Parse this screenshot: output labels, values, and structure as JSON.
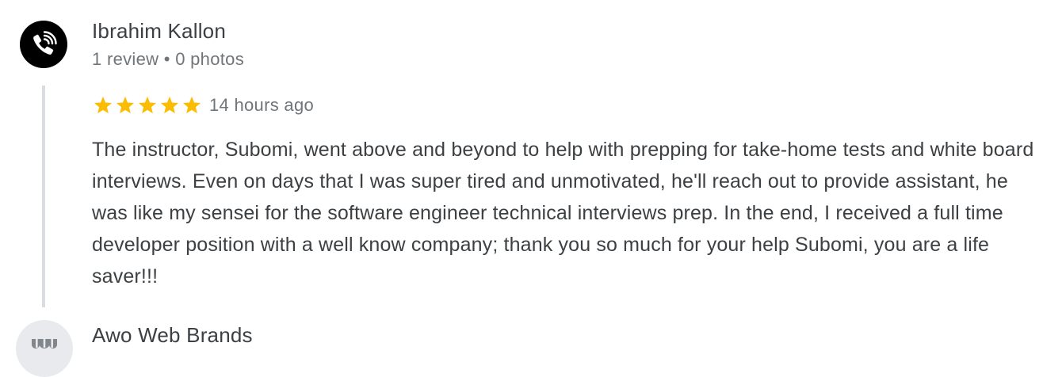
{
  "reviews": [
    {
      "reviewer_name": "Ibrahim Kallon",
      "review_count": "1 review",
      "meta_separator": "•",
      "photo_count": "0 photos",
      "avatar_icon": "phone-ringing-icon",
      "rating": 5,
      "rating_max": 5,
      "time_ago": "14 hours ago",
      "text": "The instructor, Subomi, went above and beyond to help with prepping for take-home tests and white board interviews. Even on days that I was super tired and unmotivated, he'll reach out to provide assistant, he was like my sensei for the software engineer technical interviews prep. In the end, I received a full time developer position with a well know company; thank you so much for your help Subomi, you are a life saver!!!"
    },
    {
      "reviewer_name": "Awo Web Brands",
      "avatar_icon": "storefront-icon"
    }
  ],
  "colors": {
    "star": "#fbbc04",
    "primary_text": "#3c4043",
    "secondary_text": "#70757a",
    "thread_line": "#dadce0",
    "avatar_placeholder": "#e8eaed"
  }
}
